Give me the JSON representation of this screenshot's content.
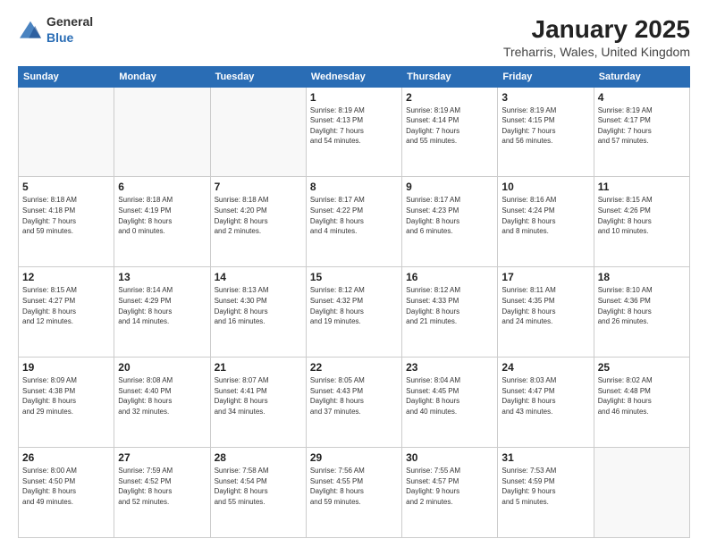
{
  "logo": {
    "general": "General",
    "blue": "Blue"
  },
  "header": {
    "title": "January 2025",
    "subtitle": "Treharris, Wales, United Kingdom"
  },
  "days_of_week": [
    "Sunday",
    "Monday",
    "Tuesday",
    "Wednesday",
    "Thursday",
    "Friday",
    "Saturday"
  ],
  "weeks": [
    [
      {
        "day": "",
        "info": ""
      },
      {
        "day": "",
        "info": ""
      },
      {
        "day": "",
        "info": ""
      },
      {
        "day": "1",
        "info": "Sunrise: 8:19 AM\nSunset: 4:13 PM\nDaylight: 7 hours\nand 54 minutes."
      },
      {
        "day": "2",
        "info": "Sunrise: 8:19 AM\nSunset: 4:14 PM\nDaylight: 7 hours\nand 55 minutes."
      },
      {
        "day": "3",
        "info": "Sunrise: 8:19 AM\nSunset: 4:15 PM\nDaylight: 7 hours\nand 56 minutes."
      },
      {
        "day": "4",
        "info": "Sunrise: 8:19 AM\nSunset: 4:17 PM\nDaylight: 7 hours\nand 57 minutes."
      }
    ],
    [
      {
        "day": "5",
        "info": "Sunrise: 8:18 AM\nSunset: 4:18 PM\nDaylight: 7 hours\nand 59 minutes."
      },
      {
        "day": "6",
        "info": "Sunrise: 8:18 AM\nSunset: 4:19 PM\nDaylight: 8 hours\nand 0 minutes."
      },
      {
        "day": "7",
        "info": "Sunrise: 8:18 AM\nSunset: 4:20 PM\nDaylight: 8 hours\nand 2 minutes."
      },
      {
        "day": "8",
        "info": "Sunrise: 8:17 AM\nSunset: 4:22 PM\nDaylight: 8 hours\nand 4 minutes."
      },
      {
        "day": "9",
        "info": "Sunrise: 8:17 AM\nSunset: 4:23 PM\nDaylight: 8 hours\nand 6 minutes."
      },
      {
        "day": "10",
        "info": "Sunrise: 8:16 AM\nSunset: 4:24 PM\nDaylight: 8 hours\nand 8 minutes."
      },
      {
        "day": "11",
        "info": "Sunrise: 8:15 AM\nSunset: 4:26 PM\nDaylight: 8 hours\nand 10 minutes."
      }
    ],
    [
      {
        "day": "12",
        "info": "Sunrise: 8:15 AM\nSunset: 4:27 PM\nDaylight: 8 hours\nand 12 minutes."
      },
      {
        "day": "13",
        "info": "Sunrise: 8:14 AM\nSunset: 4:29 PM\nDaylight: 8 hours\nand 14 minutes."
      },
      {
        "day": "14",
        "info": "Sunrise: 8:13 AM\nSunset: 4:30 PM\nDaylight: 8 hours\nand 16 minutes."
      },
      {
        "day": "15",
        "info": "Sunrise: 8:12 AM\nSunset: 4:32 PM\nDaylight: 8 hours\nand 19 minutes."
      },
      {
        "day": "16",
        "info": "Sunrise: 8:12 AM\nSunset: 4:33 PM\nDaylight: 8 hours\nand 21 minutes."
      },
      {
        "day": "17",
        "info": "Sunrise: 8:11 AM\nSunset: 4:35 PM\nDaylight: 8 hours\nand 24 minutes."
      },
      {
        "day": "18",
        "info": "Sunrise: 8:10 AM\nSunset: 4:36 PM\nDaylight: 8 hours\nand 26 minutes."
      }
    ],
    [
      {
        "day": "19",
        "info": "Sunrise: 8:09 AM\nSunset: 4:38 PM\nDaylight: 8 hours\nand 29 minutes."
      },
      {
        "day": "20",
        "info": "Sunrise: 8:08 AM\nSunset: 4:40 PM\nDaylight: 8 hours\nand 32 minutes."
      },
      {
        "day": "21",
        "info": "Sunrise: 8:07 AM\nSunset: 4:41 PM\nDaylight: 8 hours\nand 34 minutes."
      },
      {
        "day": "22",
        "info": "Sunrise: 8:05 AM\nSunset: 4:43 PM\nDaylight: 8 hours\nand 37 minutes."
      },
      {
        "day": "23",
        "info": "Sunrise: 8:04 AM\nSunset: 4:45 PM\nDaylight: 8 hours\nand 40 minutes."
      },
      {
        "day": "24",
        "info": "Sunrise: 8:03 AM\nSunset: 4:47 PM\nDaylight: 8 hours\nand 43 minutes."
      },
      {
        "day": "25",
        "info": "Sunrise: 8:02 AM\nSunset: 4:48 PM\nDaylight: 8 hours\nand 46 minutes."
      }
    ],
    [
      {
        "day": "26",
        "info": "Sunrise: 8:00 AM\nSunset: 4:50 PM\nDaylight: 8 hours\nand 49 minutes."
      },
      {
        "day": "27",
        "info": "Sunrise: 7:59 AM\nSunset: 4:52 PM\nDaylight: 8 hours\nand 52 minutes."
      },
      {
        "day": "28",
        "info": "Sunrise: 7:58 AM\nSunset: 4:54 PM\nDaylight: 8 hours\nand 55 minutes."
      },
      {
        "day": "29",
        "info": "Sunrise: 7:56 AM\nSunset: 4:55 PM\nDaylight: 8 hours\nand 59 minutes."
      },
      {
        "day": "30",
        "info": "Sunrise: 7:55 AM\nSunset: 4:57 PM\nDaylight: 9 hours\nand 2 minutes."
      },
      {
        "day": "31",
        "info": "Sunrise: 7:53 AM\nSunset: 4:59 PM\nDaylight: 9 hours\nand 5 minutes."
      },
      {
        "day": "",
        "info": ""
      }
    ]
  ]
}
